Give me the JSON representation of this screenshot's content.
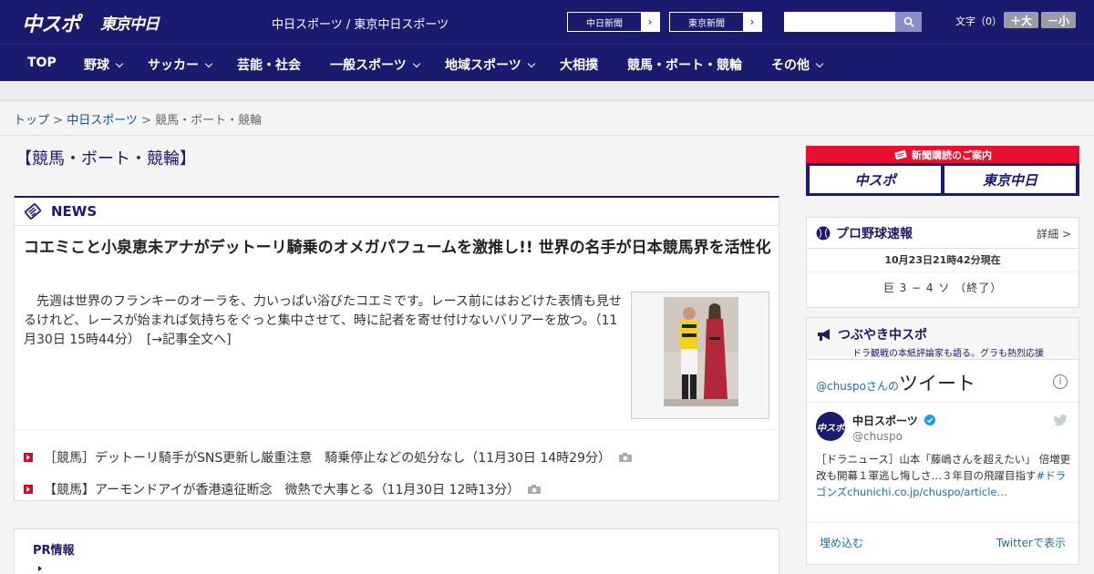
{
  "header": {
    "logo_chuspo": "中スポ",
    "logo_tokyo": "東京中日",
    "site_name": "中日スポーツ / 東京中日スポーツ",
    "paper_links": [
      {
        "label": "中日新聞"
      },
      {
        "label": "東京新聞"
      }
    ],
    "search_placeholder": "",
    "font_size_label": "文字（0）",
    "font_larger": "＋大",
    "font_smaller": "－小"
  },
  "nav": {
    "items": [
      {
        "label": "TOP",
        "dropdown": false
      },
      {
        "label": "野球",
        "dropdown": true
      },
      {
        "label": "サッカー",
        "dropdown": true
      },
      {
        "label": "芸能・社会",
        "dropdown": false
      },
      {
        "label": "一般スポーツ",
        "dropdown": true
      },
      {
        "label": "地域スポーツ",
        "dropdown": true
      },
      {
        "label": "大相撲",
        "dropdown": false
      },
      {
        "label": "競馬・ボート・競輪",
        "dropdown": false
      },
      {
        "label": "その他",
        "dropdown": true
      }
    ]
  },
  "breadcrumb": {
    "home": "トップ",
    "sep": " > ",
    "parent": "中日スポーツ",
    "current": "競馬・ボート・競輪"
  },
  "page_title": "【競馬・ボート・競輪】",
  "news": {
    "label": "NEWS",
    "headline": "コエミこと小泉恵未アナがデットーリ騎乗のオメガパフュームを激推し!! 世界の名手が日本競馬界を活性化",
    "lead": "先週は世界のフランキーのオーラを、力いっぱい浴びたコエミです。レース前にはおどけた表情も見せるけれど、レースが始まれば気持ちをぐっと集中させて、時に記者を寄せ付けないバリアーを放つ。（11月30日 15時44分）　[→記事全文へ]",
    "sub_items": [
      {
        "text": "［競馬］デットーリ騎手がSNS更新し厳重注意　騎乗停止などの処分なし（11月30日 14時29分）"
      },
      {
        "text": "【競馬】アーモンドアイが香港遠征断念　微熱で大事とる（11月30日 12時13分）"
      }
    ]
  },
  "pr": {
    "title": "PR情報"
  },
  "sidebar": {
    "subscription_banner": {
      "top": "新聞購読のご案内",
      "left_logo": "中スポ",
      "right_logo": "東京中日"
    },
    "baseball": {
      "title": "プロ野球速報",
      "more": "詳細 >",
      "time": "10月23日21時42分現在",
      "score": "巨 3 − 4 ソ （終了）"
    },
    "tweets": {
      "title": "つぶやき中スポ",
      "subtitle": "ドラ観戦の本紙評論家も語る。グラも熱烈応援",
      "handle_prefix": "@chuspo",
      "handle_suffix": "さんの",
      "widget_title": "ツイート",
      "account_name": "中日スポーツ",
      "account_handle": "@chuspo",
      "avatar_text": "中スポ",
      "tweet_text": "［ドラニュース］山本「藤嶋さんを超えたい」 倍増更改も開幕１軍逃し悔しさ…３年目の飛躍目指す",
      "tweet_link": "#ドラゴンズchunichi.co.jp/chuspo/article…",
      "embed": "埋め込む",
      "view_on_twitter": "Twitterで表示"
    }
  },
  "colors": {
    "brand_navy": "#1a1a6e",
    "accent_red": "#e8102e",
    "link_blue": "#1a6fae"
  }
}
